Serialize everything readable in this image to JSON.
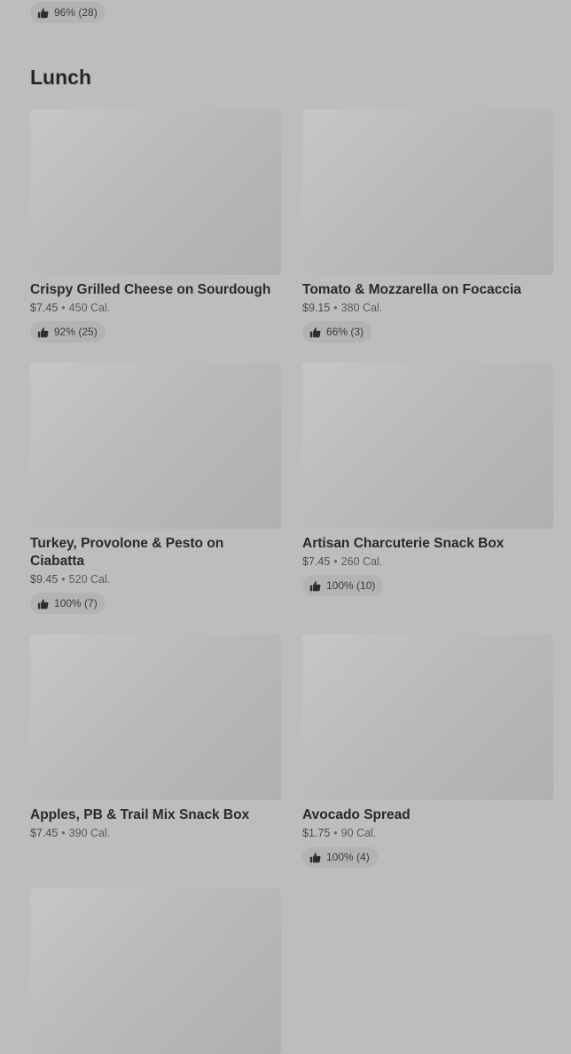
{
  "top_item": {
    "rating": "96% (28)"
  },
  "section": {
    "title": "Lunch"
  },
  "items": [
    {
      "name": "Crispy Grilled Cheese on Sourdough",
      "price": "$7.45",
      "calories": "450 Cal.",
      "rating": "92% (25)"
    },
    {
      "name": "Tomato & Mozzarella on Focaccia",
      "price": "$9.15",
      "calories": "380 Cal.",
      "rating": "66% (3)"
    },
    {
      "name": "Turkey, Provolone & Pesto on Ciabatta",
      "price": "$9.45",
      "calories": "520 Cal.",
      "rating": "100% (7)"
    },
    {
      "name": "Artisan Charcuterie Snack Box",
      "price": "$7.45",
      "calories": "260 Cal.",
      "rating": "100% (10)"
    },
    {
      "name": "Apples, PB & Trail Mix Snack Box",
      "price": "$7.45",
      "calories": "390 Cal.",
      "rating": ""
    },
    {
      "name": "Avocado Spread",
      "price": "$1.75",
      "calories": "90 Cal.",
      "rating": "100% (4)"
    }
  ],
  "icons": {
    "rating": "thumbs-up-icon"
  },
  "separator": "•"
}
